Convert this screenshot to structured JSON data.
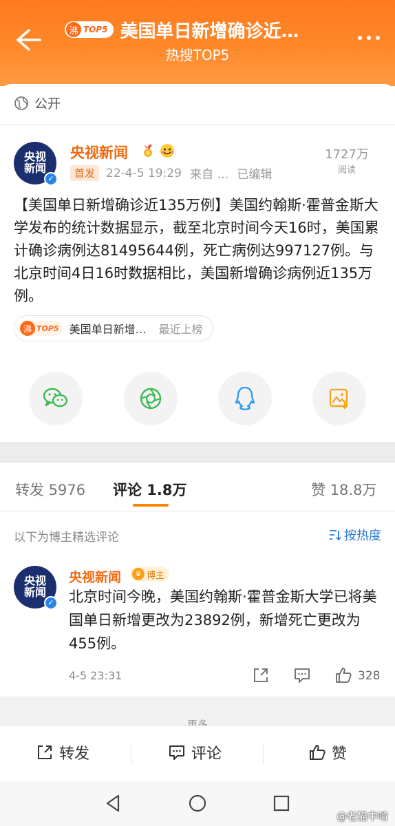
{
  "header": {
    "badge_icon": "沸",
    "badge_label": "TOP5",
    "title": "美国单日新增确诊近…",
    "subtitle": "热搜TOP5"
  },
  "post": {
    "visibility": "公开",
    "author": {
      "name": "央视新闻",
      "avatar_line1": "央视",
      "avatar_line2": "新闻"
    },
    "first_tag": "首发",
    "datetime": "22-4-5 19:29",
    "source": "来自 …",
    "edited": "已编辑",
    "reads_count": "1727万",
    "reads_label": "阅读",
    "text": "【美国单日新增确诊近135万例】美国约翰斯·霍普金斯大学发布的统计数据显示，截至北京时间今天16时，美国累计确诊病例达81495644例，死亡病例达997127例。与北京时间4日16时数据相比，美国新增确诊病例近135万例。",
    "topic_chip": {
      "badge_icon": "沸",
      "badge_label": "TOP5",
      "label": "美国单日新增…",
      "status": "最近上榜"
    }
  },
  "tabs": {
    "repost": "转发 5976",
    "comment": "评论 1.8万",
    "like": "赞 18.8万"
  },
  "comments": {
    "header": "以下为博主精选评论",
    "sort_label": "按热度",
    "items": [
      {
        "author": "央视新闻",
        "avatar_line1": "央视",
        "avatar_line2": "新闻",
        "host_tag": "博主",
        "text": "北京时间今晚，美国约翰斯·霍普金斯大学已将美国单日新增更改为23892例，新增死亡更改为455例。",
        "time": "4-5 23:31",
        "likes": "328"
      }
    ],
    "more_label": "更多"
  },
  "bottom_bar": {
    "repost": "转发",
    "comment": "评论",
    "like": "赞"
  },
  "watermark": "@老猫中啃",
  "colors": {
    "header_orange": "#ff7a1e",
    "author_orange": "#f06a0f",
    "link_blue": "#2b7bd6",
    "tab_underline": "#ff8200"
  }
}
